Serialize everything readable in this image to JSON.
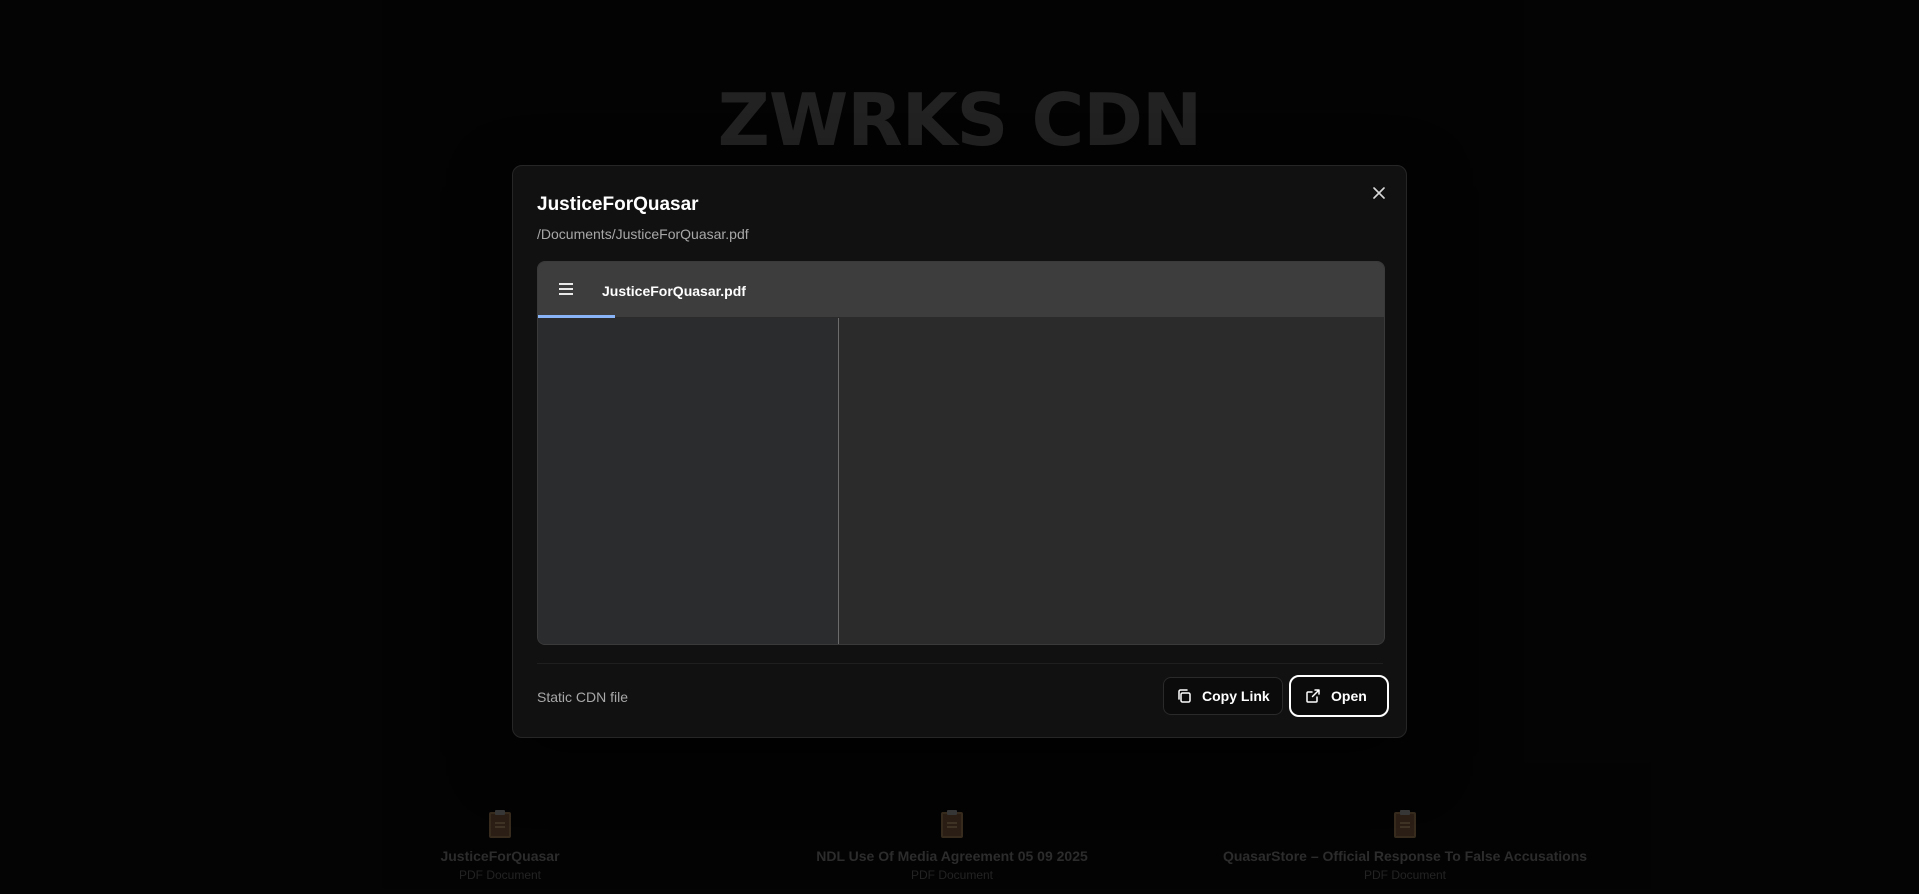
{
  "background": {
    "site_title": "ZWRKS CDN",
    "cards": [
      {
        "name": "JusticeForQuasar",
        "type": "PDF Document",
        "icon": "document-icon"
      },
      {
        "name": "NDL Use Of Media Agreement 05 09 2025",
        "type": "PDF Document",
        "icon": "document-icon"
      },
      {
        "name": "QuasarStore – Official Response To False Accusations",
        "type": "PDF Document",
        "icon": "document-icon"
      }
    ]
  },
  "modal": {
    "title": "JusticeForQuasar",
    "path": "/Documents/JusticeForQuasar.pdf",
    "close_icon": "close-icon",
    "viewer": {
      "filename": "JusticeForQuasar.pdf",
      "menu_icon": "menu-icon"
    },
    "footer": {
      "note": "Static CDN file",
      "copy_label": "Copy Link",
      "copy_icon": "copy-icon",
      "open_label": "Open",
      "open_icon": "external-link-icon"
    }
  },
  "colors": {
    "accent": "#8ab4f8",
    "modal_bg": "#111111",
    "toolbar_bg": "#3d3d3d"
  }
}
